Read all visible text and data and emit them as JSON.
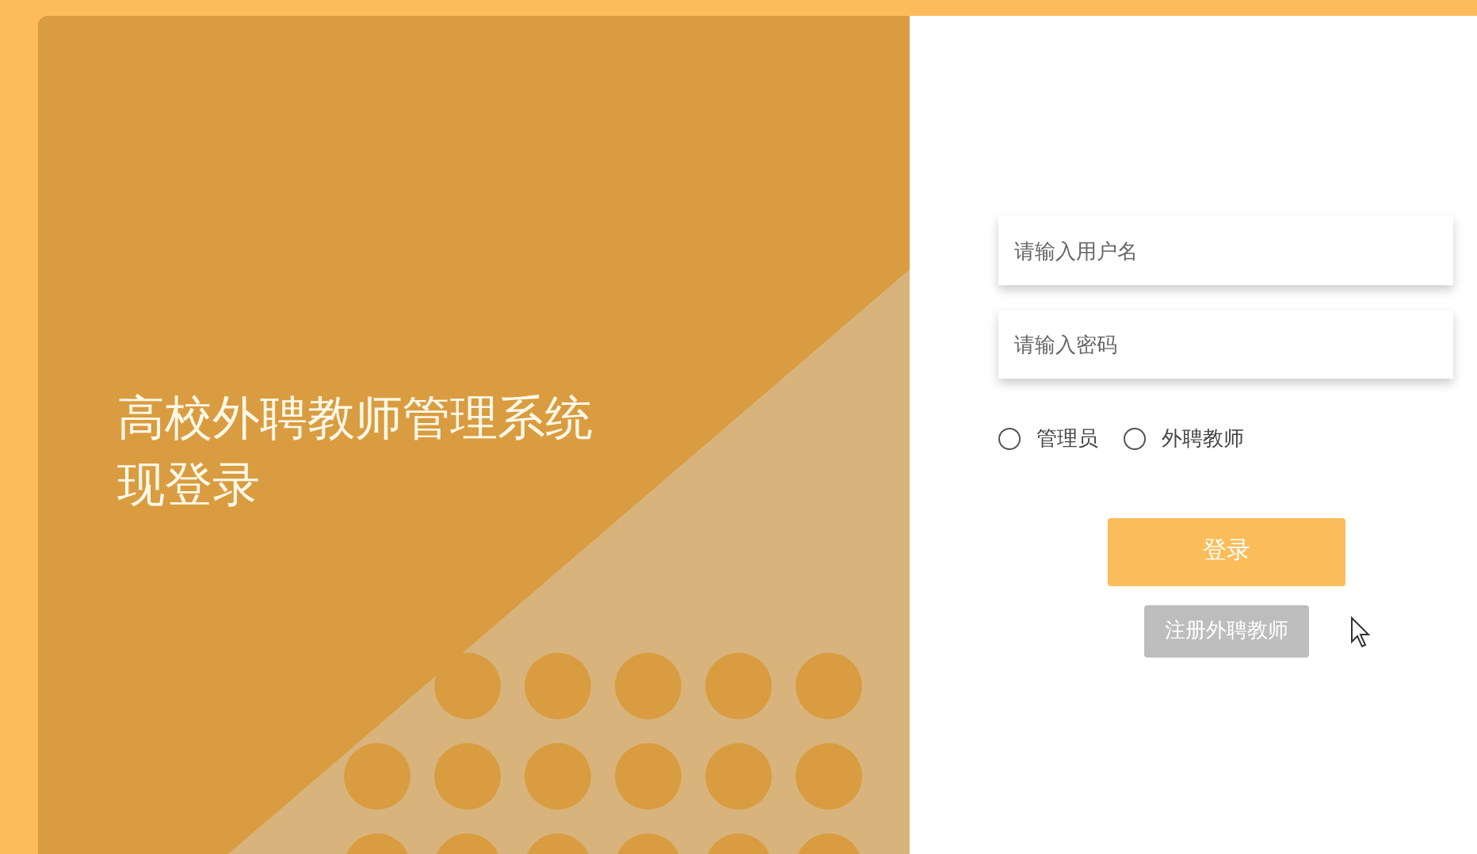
{
  "title_lines": [
    "高校外聘教师管理系统",
    "现登录"
  ],
  "form": {
    "username": {
      "placeholder": "请输入用户名"
    },
    "password": {
      "placeholder": "请输入密码"
    },
    "roles": [
      {
        "label": "管理员",
        "selected": false
      },
      {
        "label": "外聘教师",
        "selected": false
      }
    ],
    "login_button": "登录",
    "register_button": "注册外聘教师"
  }
}
